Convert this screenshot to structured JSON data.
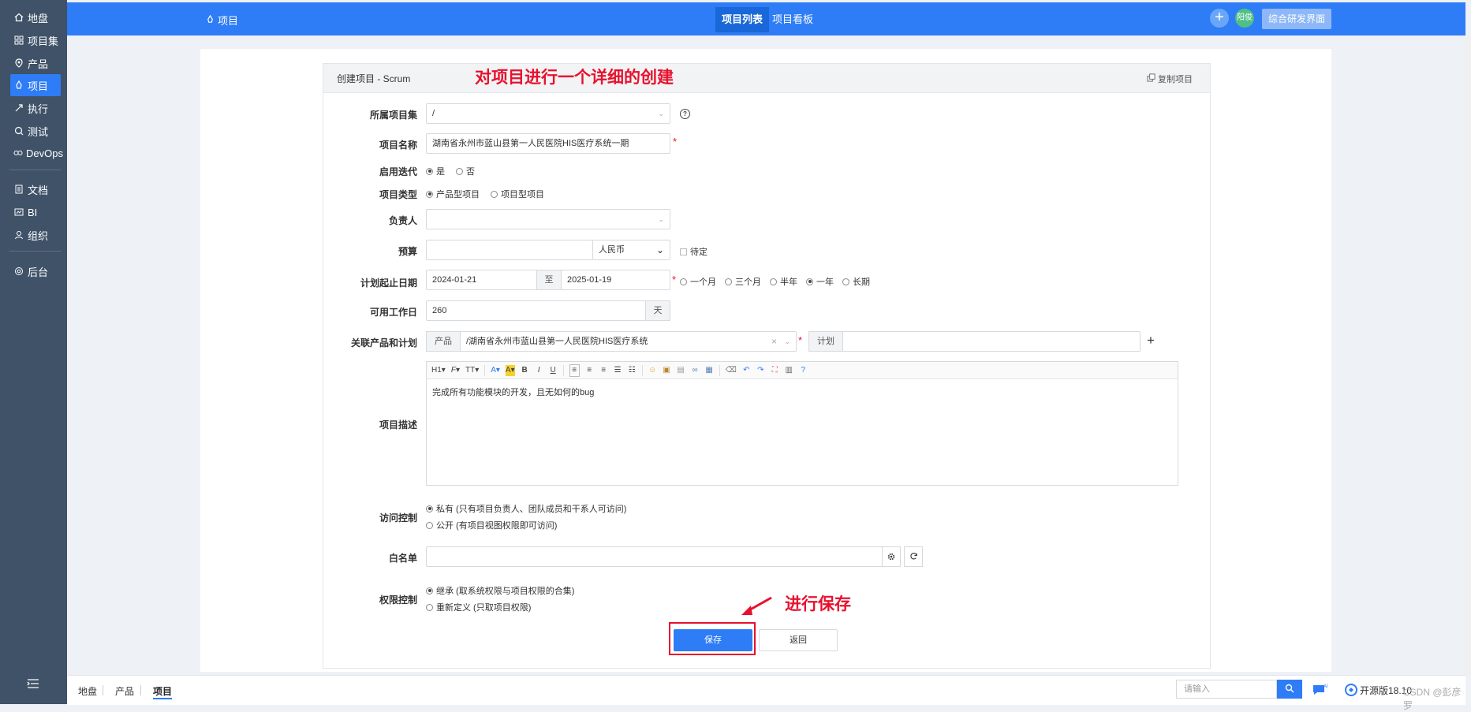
{
  "sidebar": {
    "items": [
      {
        "label": "地盘",
        "icon": "home-icon"
      },
      {
        "label": "项目集",
        "icon": "grid-icon"
      },
      {
        "label": "产品",
        "icon": "product-icon"
      },
      {
        "label": "项目",
        "icon": "project-icon",
        "active": true
      },
      {
        "label": "执行",
        "icon": "run-icon"
      },
      {
        "label": "测试",
        "icon": "test-icon"
      },
      {
        "label": "DevOps",
        "icon": "devops-icon"
      },
      {
        "label": "文档",
        "icon": "doc-icon"
      },
      {
        "label": "BI",
        "icon": "bi-icon"
      },
      {
        "label": "组织",
        "icon": "org-icon"
      },
      {
        "label": "后台",
        "icon": "settings-icon"
      }
    ],
    "toggle_icon": "menu-collapse-icon"
  },
  "topbar": {
    "section": "项目",
    "tabs": [
      "项目列表",
      "项目看板"
    ],
    "active_tab": "项目列表",
    "avatar_text": "阳俊",
    "switch_button": "综合研发界面"
  },
  "panel": {
    "title": "创建项目 - Scrum",
    "copy_link": "复制项目"
  },
  "annotations": {
    "top": "对项目进行一个详细的创建",
    "save": "进行保存"
  },
  "form": {
    "program": {
      "label": "所属项目集",
      "value": "/"
    },
    "name": {
      "label": "项目名称",
      "value": "湖南省永州市蓝山县第一人民医院HIS医疗系统一期"
    },
    "iteration": {
      "label": "启用迭代",
      "options": [
        "是",
        "否"
      ],
      "selected": "是"
    },
    "type": {
      "label": "项目类型",
      "options": [
        "产品型项目",
        "项目型项目"
      ],
      "selected": "产品型项目"
    },
    "owner": {
      "label": "负责人",
      "value": ""
    },
    "budget": {
      "label": "预算",
      "value": "",
      "currency": "人民币",
      "pending_label": "待定"
    },
    "dates": {
      "label": "计划起止日期",
      "begin": "2024-01-21",
      "separator": "至",
      "end": "2025-01-19",
      "presets": [
        "一个月",
        "三个月",
        "半年",
        "一年",
        "长期"
      ],
      "selected": "一年"
    },
    "workdays": {
      "label": "可用工作日",
      "value": "260",
      "unit": "天"
    },
    "link": {
      "label": "关联产品和计划",
      "product_addon": "产品",
      "product_value": "/湖南省永州市蓝山县第一人民医院HIS医疗系统",
      "plan_addon": "计划",
      "plan_value": ""
    },
    "description": {
      "label": "项目描述",
      "toolbar": [
        "H1",
        "F",
        "TT",
        "A",
        "A",
        "B",
        "I",
        "U"
      ],
      "value": "完成所有功能模块的开发，且无如何的bug"
    },
    "access": {
      "label": "访问控制",
      "options": [
        "私有 (只有项目负责人、团队成员和干系人可访问)",
        "公开 (有项目视图权限即可访问)"
      ],
      "selected": 0
    },
    "whitelist": {
      "label": "白名单",
      "value": ""
    },
    "acl": {
      "label": "权限控制",
      "options": [
        "继承 (取系统权限与项目权限的合集)",
        "重新定义 (只取项目权限)"
      ],
      "selected": 0
    },
    "save_button": "保存",
    "back_button": "返回"
  },
  "bottombar": {
    "crumbs": [
      "地盘",
      "产品",
      "项目"
    ],
    "search_placeholder": "请输入",
    "version": "开源版18.10",
    "watermark": "CSDN @彭彦罗"
  }
}
